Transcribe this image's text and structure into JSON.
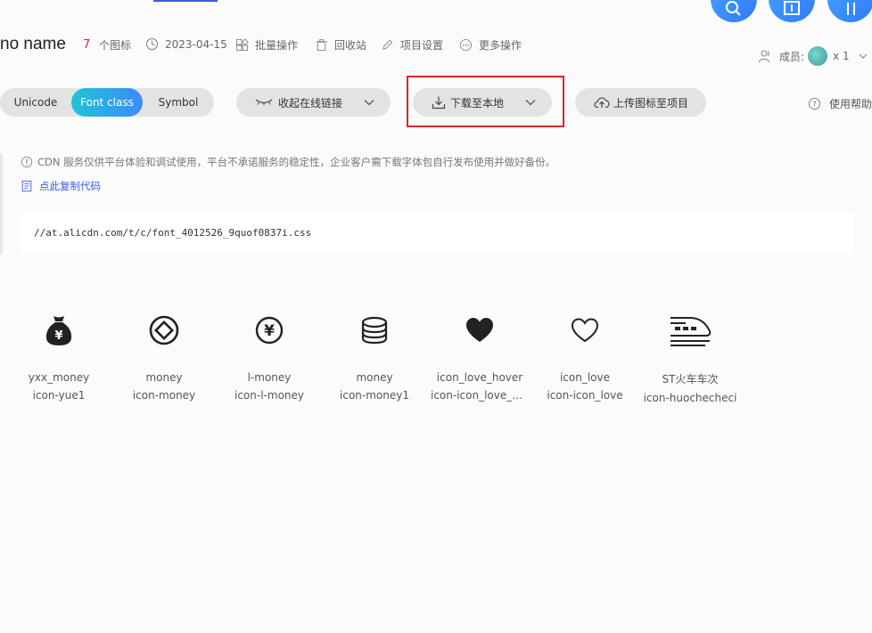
{
  "project": {
    "name": "no name",
    "icon_count": "7",
    "icon_count_label": "个图标",
    "date": "2023-04-15",
    "actions": [
      "批量操作",
      "回收站",
      "项目设置",
      "更多操作"
    ]
  },
  "members": {
    "label": "成员:",
    "count": "x 1"
  },
  "toolbar": {
    "tabs": [
      "Unicode",
      "Font class",
      "Symbol"
    ],
    "active_tab": "Font class",
    "collapse_link": "收起在线链接",
    "download": "下载至本地",
    "upload": "上传图标至项目",
    "help": "使用帮助"
  },
  "info": {
    "notice": "CDN 服务仅供平台体验和调试使用，平台不承诺服务的稳定性，企业客户需下载字体包自行发布使用并做好备份。",
    "copy_code": "点此复制代码",
    "code": "//at.alicdn.com/t/c/font_4012526_9quof0837i.css"
  },
  "icons": [
    {
      "name": "yxx_money",
      "class": "icon-yue1",
      "icon": "money-bag-icon"
    },
    {
      "name": "money",
      "class": "icon-money",
      "icon": "coin-circle-icon"
    },
    {
      "name": "l-money",
      "class": "icon-l-money",
      "icon": "yen-circle-icon"
    },
    {
      "name": "money",
      "class": "icon-money1",
      "icon": "coin-stack-icon"
    },
    {
      "name": "icon_love_hover",
      "class": "icon-icon_love_h...",
      "icon": "heart-filled-icon"
    },
    {
      "name": "icon_love",
      "class": "icon-icon_love",
      "icon": "heart-outline-icon"
    },
    {
      "name": "ST火车车次",
      "class": "icon-huochecheci",
      "icon": "train-icon"
    }
  ],
  "colors": {
    "accent": "#3d8bf8",
    "count_red": "#e0282e",
    "highlight": "#d9252b"
  }
}
